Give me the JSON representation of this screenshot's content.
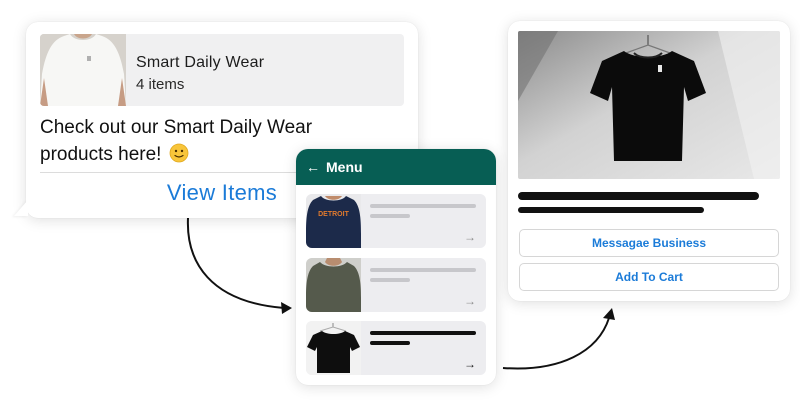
{
  "chat": {
    "catalog_title": "Smart Daily Wear",
    "catalog_count": "4 items",
    "message": "Check out our Smart Daily Wear products here!",
    "emoji_icon": "slightly-smiling-face-icon",
    "view_items_label": "View Items"
  },
  "menu": {
    "back_icon": "arrow-left-icon",
    "title": "Menu",
    "items": [
      {
        "shirt_color": "#1c2a4a",
        "print_text": "DETROIT",
        "print_color": "#e07a2e",
        "skeleton": "#c7c7cb",
        "arrow": "→"
      },
      {
        "shirt_color": "#555a4c",
        "print_text": "",
        "print_color": "",
        "skeleton": "#c7c7cb",
        "arrow": "→"
      },
      {
        "shirt_color": "#0e0e0e",
        "print_text": "",
        "print_color": "",
        "skeleton": "#111111",
        "arrow": "→"
      }
    ]
  },
  "product": {
    "image": "black-tshirt-on-hanger",
    "message_button_label": "Messagae Business",
    "cart_button_label": "Add To Cart"
  },
  "colors": {
    "link_blue": "#1b7bd8",
    "header_green": "#075e54",
    "skeleton_grey": "#c7c7cb"
  }
}
